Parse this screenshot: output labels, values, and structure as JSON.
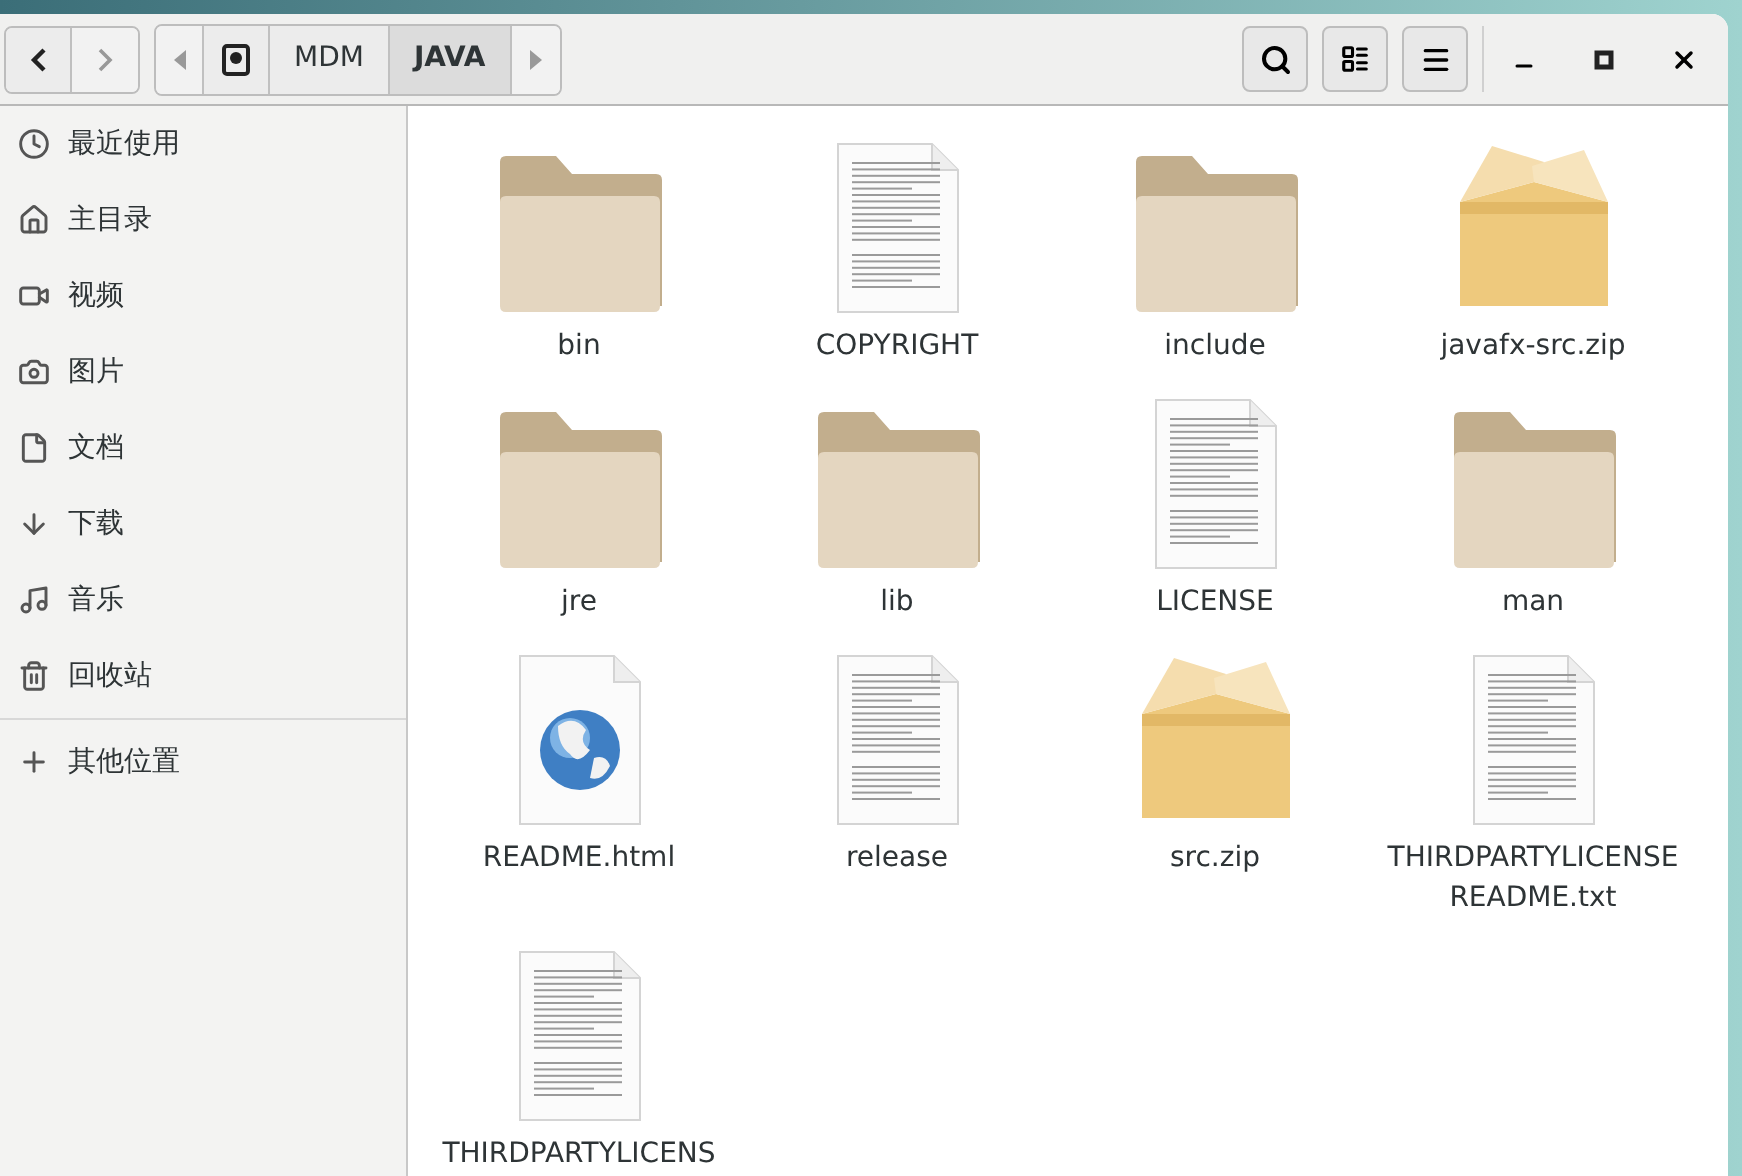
{
  "path": [
    {
      "kind": "drive",
      "selected": false
    },
    {
      "kind": "folder",
      "label": "MDM",
      "selected": false
    },
    {
      "kind": "folder",
      "label": "JAVA",
      "selected": true
    }
  ],
  "sidebar": {
    "items": [
      {
        "kind": "recent",
        "label": "最近使用"
      },
      {
        "kind": "home",
        "label": "主目录"
      },
      {
        "kind": "video",
        "label": "视频"
      },
      {
        "kind": "pictures",
        "label": "图片"
      },
      {
        "kind": "documents",
        "label": "文档"
      },
      {
        "kind": "downloads",
        "label": "下载"
      },
      {
        "kind": "music",
        "label": "音乐"
      },
      {
        "kind": "trash",
        "label": "回收站"
      }
    ],
    "other": {
      "kind": "other",
      "label": "其他位置"
    }
  },
  "files": [
    {
      "kind": "folder",
      "name": "bin"
    },
    {
      "kind": "text",
      "name": "COPYRIGHT"
    },
    {
      "kind": "folder",
      "name": "include"
    },
    {
      "kind": "archive",
      "name": "javafx-src.zip"
    },
    {
      "kind": "folder",
      "name": "jre"
    },
    {
      "kind": "folder",
      "name": "lib"
    },
    {
      "kind": "text",
      "name": "LICENSE"
    },
    {
      "kind": "folder",
      "name": "man"
    },
    {
      "kind": "html",
      "name": "README.html"
    },
    {
      "kind": "text",
      "name": "release"
    },
    {
      "kind": "archive",
      "name": "src.zip"
    },
    {
      "kind": "text",
      "name": "THIRDPARTYLICENSEREADME.txt"
    },
    {
      "kind": "text",
      "name": "THIRDPARTYLICENS"
    }
  ]
}
